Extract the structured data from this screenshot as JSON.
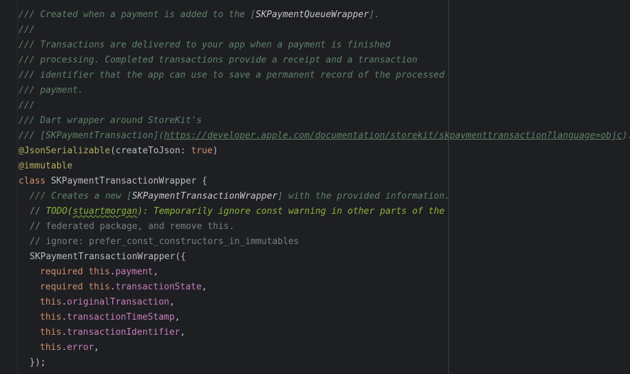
{
  "lines": {
    "l1a": "/// Created when a payment is added to the [",
    "l1b": "SKPaymentQueueWrapper",
    "l1c": "].",
    "l2": "///",
    "l3": "/// Transactions are delivered to your app when a payment is finished",
    "l4": "/// processing. Completed transactions provide a receipt and a transaction",
    "l5": "/// identifier that the app can use to save a permanent record of the processed",
    "l6": "/// payment.",
    "l7": "///",
    "l8": "/// Dart wrapper around StoreKit's",
    "l9a": "/// [SKPaymentTransaction](",
    "l9b": "https://developer.apple.com/documentation/storekit/skpaymenttransaction?language=objc",
    "l9c": ").",
    "l10a": "@JsonSerializable",
    "l10b": "(createToJson: ",
    "l10c": "true",
    "l10d": ")",
    "l11": "@immutable",
    "l12a": "class",
    "l12b": " SKPaymentTransactionWrapper {",
    "l13a": "/// Creates a new [",
    "l13b": "SKPaymentTransactionWrapper",
    "l13c": "] with the provided information.",
    "l14a": "// ",
    "l14b": "TODO(",
    "l14c": "stuartmorgan",
    "l14d": "): Temporarily ignore const warning in other parts of the",
    "l15": "// federated package, and remove this.",
    "l16": "// ignore: prefer_const_constructors_in_immutables",
    "l17": "SKPaymentTransactionWrapper({",
    "l18a": "required",
    "l18b": "this",
    "l18c": "payment",
    "l19a": "required",
    "l19b": "this",
    "l19c": "transactionState",
    "l20a": "this",
    "l20b": "originalTransaction",
    "l21a": "this",
    "l21b": "transactionTimeStamp",
    "l22a": "this",
    "l22b": "transactionIdentifier",
    "l23a": "this",
    "l23b": "error",
    "l24": "});"
  }
}
